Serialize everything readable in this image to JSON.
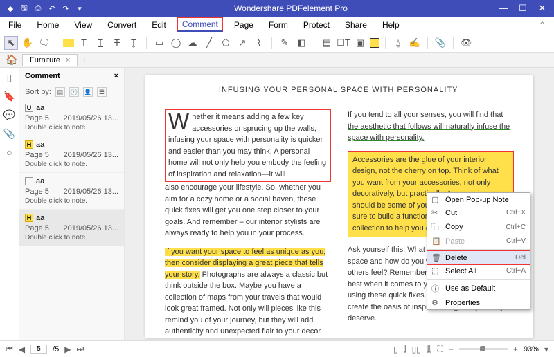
{
  "titlebar": {
    "title": "Wondershare PDFelement Pro"
  },
  "menu": {
    "items": [
      "File",
      "Home",
      "View",
      "Convert",
      "Edit",
      "Comment",
      "Page",
      "Form",
      "Protect",
      "Share",
      "Help"
    ],
    "activeIndex": 5
  },
  "tabs": {
    "doc": "Furniture"
  },
  "sidebar": {
    "title": "Comment",
    "sortby": "Sort by:",
    "items": [
      {
        "mark": "U",
        "markClass": "",
        "author": "aa",
        "page": "Page 5",
        "date": "2019/05/26 13...",
        "note": "Double click to note."
      },
      {
        "mark": "H",
        "markClass": "h",
        "author": "aa",
        "page": "Page 5",
        "date": "2019/05/26 13...",
        "note": "Double click to note."
      },
      {
        "mark": "",
        "markClass": "",
        "author": "aa",
        "page": "Page 5",
        "date": "2019/05/26 13...",
        "note": "Double click to note."
      },
      {
        "mark": "H",
        "markClass": "h",
        "author": "aa",
        "page": "Page 5",
        "date": "2019/05/26 13...",
        "note": "Double click to note."
      }
    ],
    "selectedIndex": 3
  },
  "document": {
    "heading": "INFUSING YOUR PERSONAL SPACE WITH PERSONALITY.",
    "leftCol": {
      "p1": "Whether it means adding a few key accessories or sprucing up the walls, infusing your space with personality is quicker and easier than you may think. A personal home will not only help you embody the feeling of inspiration and relaxation—it will",
      "p1b": "also encourage your lifestyle. So, whether you aim for a cozy home or a social haven, these quick fixes will get you one step closer to your goals. And remember – our interior stylists are always ready to help you in your process.",
      "p2hl": "If you want your space to feel as unique as you, then consider displaying a great piece that tells your story.",
      "p2b": " Photographs are always a classic but think outside the box. Maybe you have a collection of maps from your travels that would look great framed. Not only will pieces like this remind you of your journey, but they will add authenticity and unexpected flair to your decor."
    },
    "rightCol": {
      "p1u": "If you tend to all your senses, you will find that the aesthetic that follows will naturally infuse the space with personality.",
      "p2box": "Accessories are the glue of your interior design, not the cherry on top. Think of what you want from your accessories, not only decoratively, but practically. Accessories should be some of your greatest allies, so be sure to build a functional accessories collection to help you enjoy your space.",
      "p3": "Ask yourself this: What is the purpose of your space and how do you want to make you and others feel? Remember that you always knows best when it comes to your own space, and by using these quick fixes as a guide, you can create the oasis of inspired living that you truly deserve."
    }
  },
  "contextMenu": {
    "items": [
      {
        "icon": "▢",
        "label": "Open Pop-up Note",
        "shortcut": "",
        "state": ""
      },
      {
        "icon": "✂",
        "label": "Cut",
        "shortcut": "Ctrl+X",
        "state": ""
      },
      {
        "icon": "⿻",
        "label": "Copy",
        "shortcut": "Ctrl+C",
        "state": ""
      },
      {
        "icon": "📋",
        "label": "Paste",
        "shortcut": "Ctrl+V",
        "state": "disabled"
      },
      {
        "icon": "🗑",
        "label": "Delete",
        "shortcut": "Del",
        "state": "highlighted"
      },
      {
        "icon": "⬚",
        "label": "Select All",
        "shortcut": "Ctrl+A",
        "state": ""
      },
      {
        "icon": "ⓘ",
        "label": "Use as Default",
        "shortcut": "",
        "state": ""
      },
      {
        "icon": "⚙",
        "label": "Properties",
        "shortcut": "",
        "state": ""
      }
    ]
  },
  "statusbar": {
    "page": "5",
    "total": "/5",
    "zoom": "93%"
  }
}
